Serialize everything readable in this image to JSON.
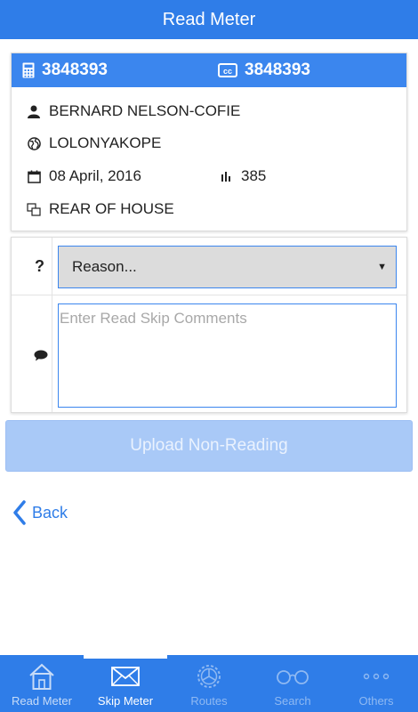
{
  "header": {
    "title": "Read Meter"
  },
  "meter": {
    "number": "3848393",
    "cc_number": "3848393",
    "customer_name": "BERNARD NELSON-COFIE",
    "location": "LOLONYAKOPE",
    "date": "08 April, 2016",
    "reading": "385",
    "meter_position": "REAR OF HOUSE"
  },
  "form": {
    "reason_question": "?",
    "reason_selected": "Reason...",
    "comment_placeholder": "Enter Read Skip Comments"
  },
  "actions": {
    "upload_label": "Upload Non-Reading",
    "back_label": "Back"
  },
  "tabs": [
    {
      "label": "Read Meter",
      "icon": "house-icon"
    },
    {
      "label": "Skip Meter",
      "icon": "envelope-icon",
      "active": true
    },
    {
      "label": "Routes",
      "icon": "gear-icon"
    },
    {
      "label": "Search",
      "icon": "glasses-icon"
    },
    {
      "label": "Others",
      "icon": "ellipsis-icon"
    }
  ],
  "colors": {
    "primary": "#2f7de8",
    "header_card": "#3b86ee",
    "upload_disabled": "#a9c9f7"
  }
}
